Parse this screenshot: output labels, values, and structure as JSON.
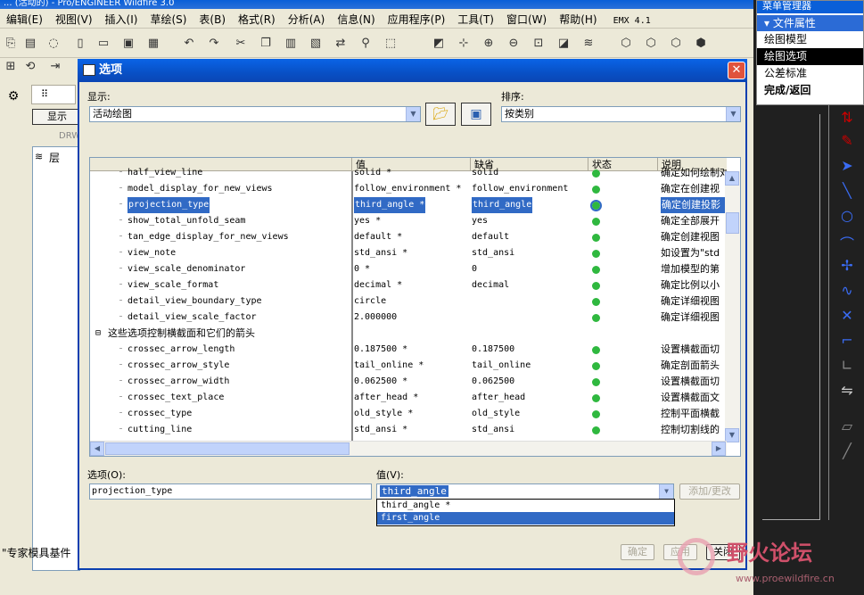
{
  "app": {
    "title": "... (活动的) - Pro/ENGINEER Wildfire 3.0",
    "menu": [
      "编辑(E)",
      "视图(V)",
      "插入(I)",
      "草绘(S)",
      "表(B)",
      "格式(R)",
      "分析(A)",
      "信息(N)",
      "应用程序(P)",
      "工具(T)",
      "窗口(W)",
      "帮助(H)",
      "EMX 4.1"
    ],
    "tree_tab_label": "显示",
    "tree_item_label": "DRW",
    "tree_layer_label": "层",
    "status_text": "\"专家模具基件"
  },
  "menu_manager": {
    "title": "菜单管理器",
    "section": "文件属性",
    "items": [
      {
        "label": "绘图模型",
        "selected": false,
        "bold": false
      },
      {
        "label": "绘图选项",
        "selected": true,
        "bold": false
      },
      {
        "label": "公差标准",
        "selected": false,
        "bold": false
      },
      {
        "label": "完成/返回",
        "selected": false,
        "bold": true
      }
    ]
  },
  "dialog": {
    "title": "选项",
    "show_label": "显示:",
    "show_value": "活动绘图",
    "sort_label": "排序:",
    "sort_value": "按类别",
    "columns": [
      "值",
      "缺省",
      "状态",
      "说明"
    ],
    "rows": [
      {
        "name": "half_view_line",
        "value": "solid *",
        "default": "solid",
        "desc": "确定如何绘制对",
        "indent": 2
      },
      {
        "name": "model_display_for_new_views",
        "value": "follow_environment *",
        "default": "follow_environment",
        "desc": "确定在创建视",
        "indent": 2
      },
      {
        "name": "projection_type",
        "value": "third_angle *",
        "default": "third_angle",
        "desc": "确定创建投影",
        "indent": 2,
        "selected": true
      },
      {
        "name": "show_total_unfold_seam",
        "value": "yes *",
        "default": "yes",
        "desc": "确定全部展开",
        "indent": 2
      },
      {
        "name": "tan_edge_display_for_new_views",
        "value": "default *",
        "default": "default",
        "desc": "确定创建视图",
        "indent": 2
      },
      {
        "name": "view_note",
        "value": "std_ansi *",
        "default": "std_ansi",
        "desc": "如设置为\"std",
        "indent": 2
      },
      {
        "name": "view_scale_denominator",
        "value": "0 *",
        "default": "0",
        "desc": "增加模型的第",
        "indent": 2
      },
      {
        "name": "view_scale_format",
        "value": "decimal *",
        "default": "decimal",
        "desc": "确定比例以小",
        "indent": 2
      },
      {
        "name": "detail_view_boundary_type",
        "value": "circle",
        "default": "",
        "desc": "确定详细视图",
        "indent": 2
      },
      {
        "name": "detail_view_scale_factor",
        "value": "2.000000",
        "default": "",
        "desc": "确定详细视图",
        "indent": 2
      },
      {
        "name": "这些选项控制横截面和它们的箭头",
        "value": "",
        "default": "",
        "desc": "",
        "indent": 0,
        "group": true
      },
      {
        "name": "crossec_arrow_length",
        "value": "0.187500 *",
        "default": "0.187500",
        "desc": "设置横截面切",
        "indent": 2
      },
      {
        "name": "crossec_arrow_style",
        "value": "tail_online *",
        "default": "tail_online",
        "desc": "确定剖面箭头",
        "indent": 2
      },
      {
        "name": "crossec_arrow_width",
        "value": "0.062500 *",
        "default": "0.062500",
        "desc": "设置横截面切",
        "indent": 2
      },
      {
        "name": "crossec_text_place",
        "value": "after_head *",
        "default": "after_head",
        "desc": "设置横截面文",
        "indent": 2
      },
      {
        "name": "crossec_type",
        "value": "old_style *",
        "default": "old_style",
        "desc": "控制平面横截",
        "indent": 2
      },
      {
        "name": "cutting_line",
        "value": "std_ansi *",
        "default": "std_ansi",
        "desc": "控制切割线的",
        "indent": 2
      }
    ],
    "option_label": "选项(O):",
    "option_value": "projection_type",
    "value_label": "值(V):",
    "value_current": "third_angle",
    "value_options": [
      "third_angle *",
      "first_angle"
    ],
    "add_change": "添加/更改",
    "ok": "确定",
    "apply": "应用",
    "close": "关闭"
  },
  "watermark": {
    "text": "野火论坛",
    "url": "www.proewildfire.cn"
  },
  "colors": {
    "title_blue": "#0a5fd8",
    "selection": "#316ac5",
    "status_green": "#2fb83f"
  }
}
